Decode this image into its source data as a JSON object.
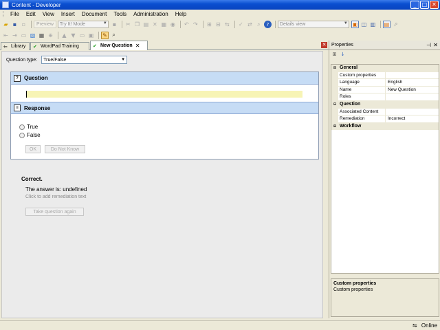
{
  "window": {
    "title": "Content - Developer"
  },
  "menu": [
    "File",
    "Edit",
    "View",
    "Insert",
    "Document",
    "Tools",
    "Administration",
    "Help"
  ],
  "toolbar": {
    "preview_label": "Preview",
    "mode_combo": "Try It! Mode",
    "view_combo": "Details view"
  },
  "tabs": [
    {
      "label": "Library",
      "icon": "library-icon"
    },
    {
      "label": "WordPad Training",
      "icon": "check-icon"
    },
    {
      "label": "New Question",
      "icon": "check-icon",
      "active": true
    }
  ],
  "question_type": {
    "label": "Question type:",
    "value": "True/False"
  },
  "question": {
    "header": "Question",
    "text": ""
  },
  "response": {
    "header": "Response",
    "options": [
      "True",
      "False"
    ],
    "ok_label": "OK",
    "dont_know_label": "Do Not Know"
  },
  "feedback": {
    "status": "Correct.",
    "answer": "The answer is: undefined",
    "remediation_hint": "Click to add remediation text",
    "retry_label": "Take question again"
  },
  "properties": {
    "title": "Properties",
    "categories": [
      {
        "name": "General",
        "expanded": true,
        "rows": [
          {
            "name": "Custom properties",
            "value": ""
          },
          {
            "name": "Language",
            "value": "English"
          },
          {
            "name": "Name",
            "value": "New Question"
          },
          {
            "name": "Roles",
            "value": ""
          }
        ]
      },
      {
        "name": "Question",
        "expanded": true,
        "rows": [
          {
            "name": "Associated Content",
            "value": ""
          },
          {
            "name": "Remediation",
            "value": "Incorrect"
          }
        ]
      },
      {
        "name": "Workflow",
        "expanded": false,
        "rows": []
      }
    ],
    "description_title": "Custom properties",
    "description_text": "Custom properties"
  },
  "status": {
    "connection": "Online"
  },
  "colors": {
    "title_bar": "#0a4fd0",
    "section_header": "#c6dcf5",
    "question_input": "#f7f4b5"
  }
}
